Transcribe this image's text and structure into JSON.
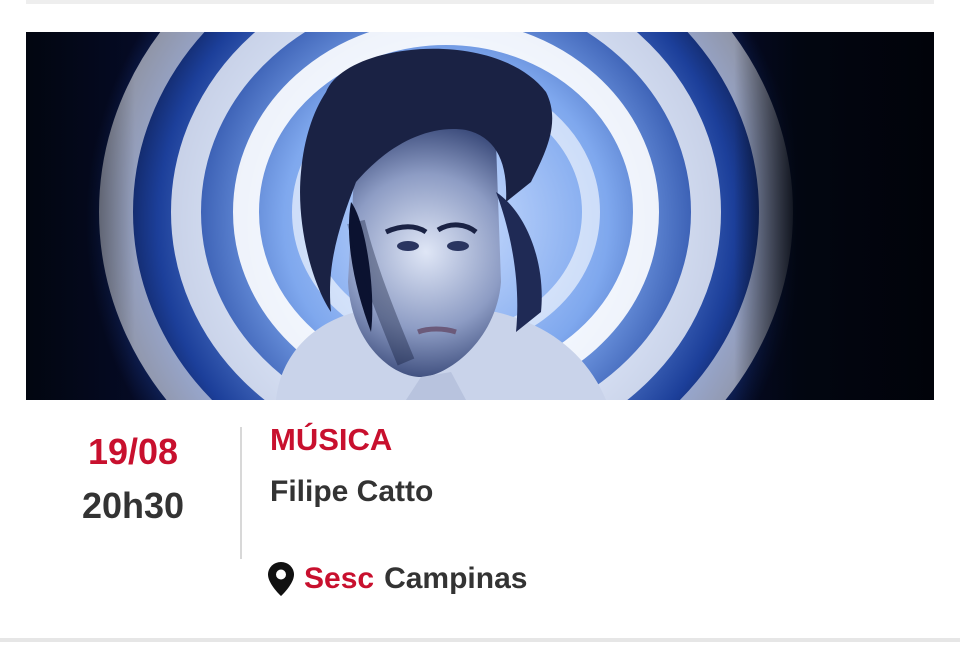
{
  "event": {
    "image_alt": "Filipe Catto",
    "date": "19/08",
    "time": "20h30",
    "category": "MÚSICA",
    "title": "Filipe Catto",
    "venue_brand": "Sesc",
    "venue_city": "Campinas"
  },
  "colors": {
    "accent": "#c8102e",
    "text": "#333333",
    "divider": "#d8d8d8"
  },
  "icons": {
    "location": "map-pin-icon"
  }
}
